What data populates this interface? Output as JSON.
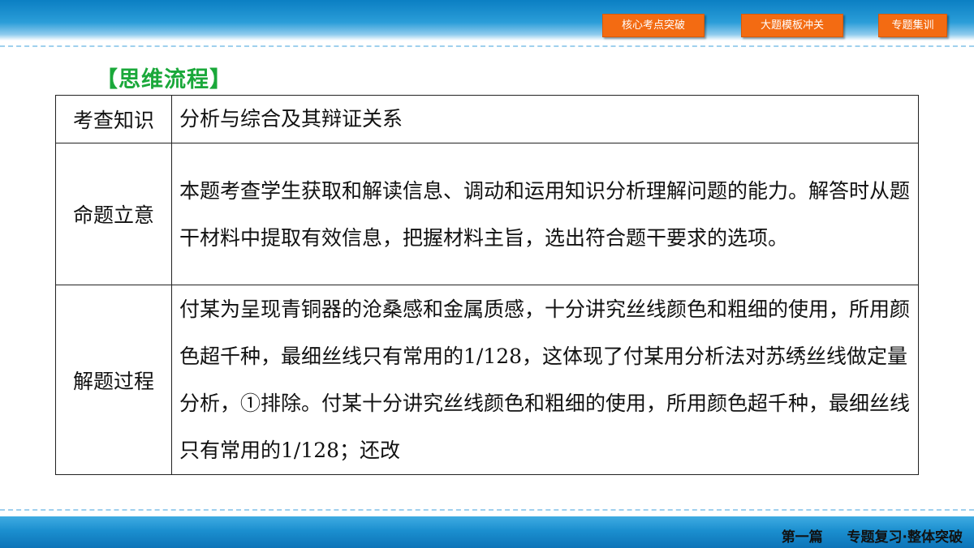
{
  "nav": {
    "buttons": [
      "核心考点突破",
      "大题模板冲关",
      "专题集训"
    ]
  },
  "section_title": "【思维流程】",
  "table": {
    "rows": [
      {
        "label": "考查知识",
        "content": "分析与综合及其辩证关系"
      },
      {
        "label": "命题立意",
        "content": "本题考查学生获取和解读信息、调动和运用知识分析理解问题的能力。解答时从题干材料中提取有效信息，把握材料主旨，选出符合题干要求的选项。"
      },
      {
        "label": "解题过程",
        "content": "付某为呈现青铜器的沧桑感和金属质感，十分讲究丝线颜色和粗细的使用，所用颜色超千种，最细丝线只有常用的1/128，这体现了付某用分析法对苏绣丝线做定量分析，①排除。付某十分讲究丝线颜色和粗细的使用，所用颜色超千种，最细丝线只有常用的1/128；还改"
      }
    ]
  },
  "footer": {
    "part": "第一篇",
    "subtitle": "专题复习·整体突破"
  },
  "colors": {
    "nav_button": "#f36b12",
    "title": "#1aa83a",
    "band": "#1b8fcf"
  }
}
